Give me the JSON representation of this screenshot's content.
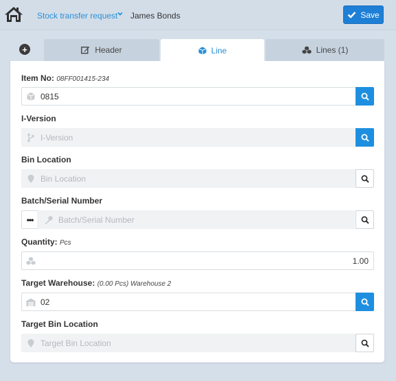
{
  "header": {
    "breadcrumb": "Stock transfer request",
    "user": "James Bonds",
    "save_label": "Save"
  },
  "tabs": [
    {
      "label": "Header",
      "icon": "edit-icon"
    },
    {
      "label": "Line",
      "icon": "cube-icon",
      "active": true
    },
    {
      "label": "Lines (1)",
      "icon": "cubes-icon"
    }
  ],
  "form": {
    "item_no": {
      "label": "Item No:",
      "sub": "08FF001415-234",
      "value": "0815"
    },
    "i_version": {
      "label": "I-Version",
      "placeholder": "I-Version"
    },
    "bin_location": {
      "label": "Bin Location",
      "placeholder": "Bin Location"
    },
    "batch_serial": {
      "label": "Batch/Serial Number",
      "placeholder": "Batch/Serial Number",
      "more": "•••"
    },
    "quantity": {
      "label": "Quantity:",
      "sub": "Pcs",
      "value": "1.00"
    },
    "target_warehouse": {
      "label": "Target Warehouse:",
      "sub": "(0.00 Pcs) Warehouse 2",
      "value": "02"
    },
    "target_bin_location": {
      "label": "Target Bin Location",
      "placeholder": "Target Bin Location"
    }
  },
  "colors": {
    "accent": "#1e8fe0",
    "save": "#1e7fd6",
    "background": "#d5dfea"
  }
}
